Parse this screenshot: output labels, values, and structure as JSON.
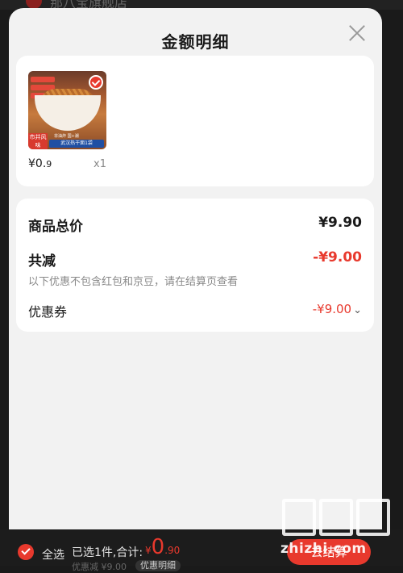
{
  "background": {
    "store_name": "那八宝旗舰店"
  },
  "modal": {
    "title": "金额明细"
  },
  "product": {
    "image_labels": {
      "brand": "市井风味",
      "name_pre": "非油炸 国+潮",
      "name": "武汉热干面1袋"
    },
    "price_int": "¥0.",
    "price_dec": "9",
    "qty": "x1"
  },
  "summary": {
    "total_label": "商品总价",
    "total_value": "¥9.90",
    "reduce_label": "共减",
    "reduce_value": "-¥9.00",
    "reduce_note": "以下优惠不包含红包和京豆，请在结算页查看",
    "coupon_label": "优惠券",
    "coupon_value": "-¥9.00"
  },
  "bottom_bar": {
    "select_all": "全选",
    "selected_info": "已选1件,合计:",
    "price_currency": "¥",
    "price_int": "0",
    "price_dec": ".90",
    "sub_text": "优惠减 ¥9.00",
    "detail_btn": "优惠明细",
    "checkout": "去结算"
  },
  "watermark": {
    "text": "zhizhi.com"
  },
  "colors": {
    "accent": "#e8392d",
    "sheet_bg": "#f2f2f2",
    "card_bg": "#ffffff",
    "bar_bg": "#1c1c1c"
  }
}
